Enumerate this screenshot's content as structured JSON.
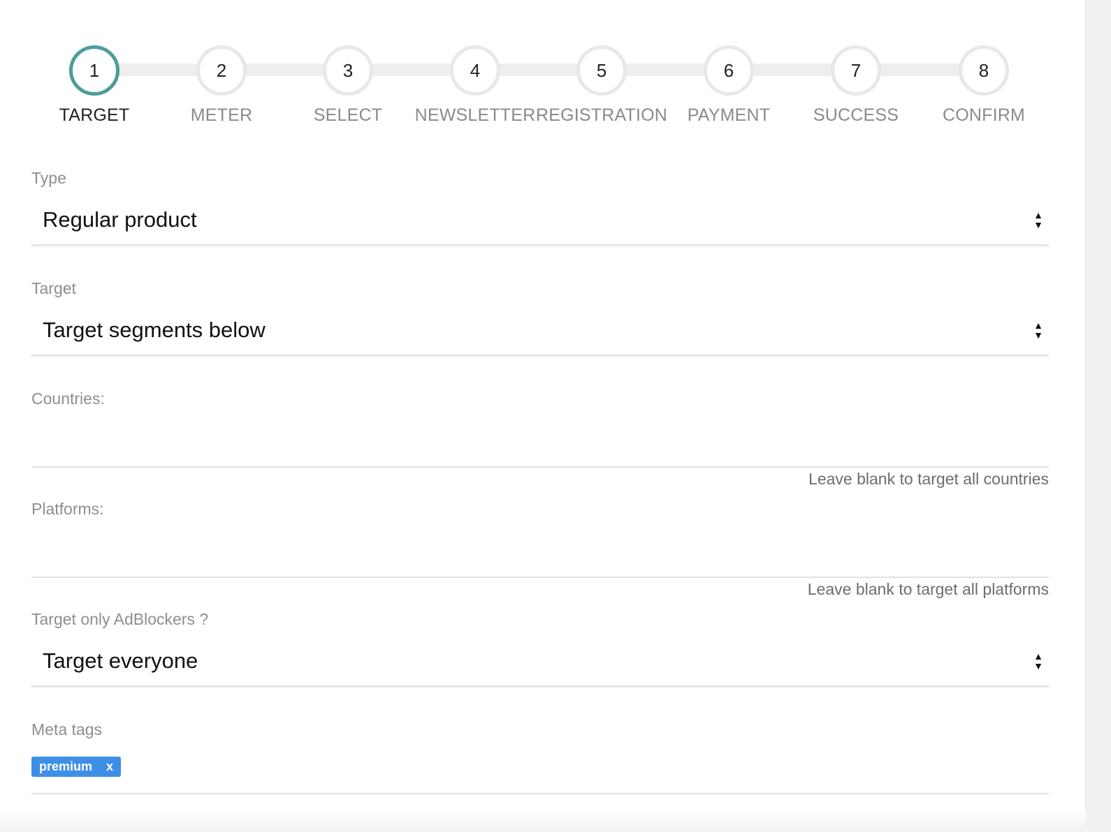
{
  "stepper": {
    "steps": [
      {
        "number": "1",
        "label": "TARGET",
        "active": true
      },
      {
        "number": "2",
        "label": "METER",
        "active": false
      },
      {
        "number": "3",
        "label": "SELECT",
        "active": false
      },
      {
        "number": "4",
        "label": "NEWSLETTER",
        "active": false
      },
      {
        "number": "5",
        "label": "REGISTRATION",
        "active": false
      },
      {
        "number": "6",
        "label": "PAYMENT",
        "active": false
      },
      {
        "number": "7",
        "label": "SUCCESS",
        "active": false
      },
      {
        "number": "8",
        "label": "CONFIRM",
        "active": false
      }
    ],
    "active_color": "#4a9e98"
  },
  "form": {
    "type": {
      "label": "Type",
      "value": "Regular product"
    },
    "target": {
      "label": "Target",
      "value": "Target segments below"
    },
    "countries": {
      "label": "Countries:",
      "value": "",
      "hint": "Leave blank to target all countries"
    },
    "platforms": {
      "label": "Platforms:",
      "value": "",
      "hint": "Leave blank to target all platforms"
    },
    "adblockers": {
      "label": "Target only AdBlockers ?",
      "value": "Target everyone"
    },
    "meta_tags": {
      "label": "Meta tags",
      "tags": [
        {
          "text": "premium",
          "remove": "x"
        }
      ],
      "tag_color": "#3d8fe6"
    }
  }
}
